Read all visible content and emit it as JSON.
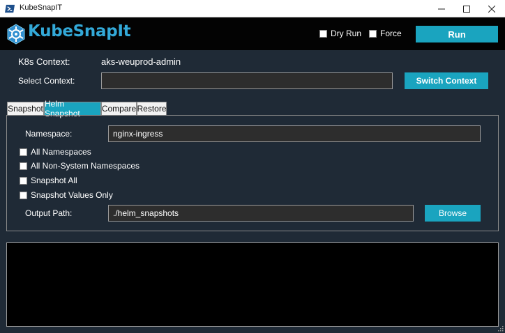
{
  "window": {
    "title": "KubeSnapIT"
  },
  "header": {
    "logo_text": "KubeSnapIt",
    "dry_run_label": "Dry Run",
    "force_label": "Force",
    "run_label": "Run"
  },
  "context": {
    "k8s_label": "K8s Context:",
    "k8s_value": "aks-weuprod-admin",
    "select_label": "Select Context:",
    "select_value": "",
    "switch_label": "Switch Context"
  },
  "tabs": [
    {
      "label": "Snapshot"
    },
    {
      "label": "Helm Snapshot",
      "active": true
    },
    {
      "label": "Compare"
    },
    {
      "label": "Restore"
    }
  ],
  "helm": {
    "namespace_label": "Namespace:",
    "namespace_value": "nginx-ingress",
    "options": [
      {
        "label": "All Namespaces",
        "checked": false
      },
      {
        "label": "All Non-System Namespaces",
        "checked": false
      },
      {
        "label": "Snapshot All",
        "checked": false
      },
      {
        "label": "Snapshot Values Only",
        "checked": false
      }
    ],
    "output_label": "Output Path:",
    "output_value": "./helm_snapshots",
    "browse_label": "Browse"
  },
  "colors": {
    "accent": "#1aa4bf",
    "background": "#1f2a36",
    "header": "#030303",
    "logo": "#33a9d8"
  },
  "icons": [
    "powershell-icon",
    "minimize-icon",
    "maximize-icon",
    "close-icon",
    "kubernetes-logo-icon",
    "resize-grip-icon"
  ]
}
